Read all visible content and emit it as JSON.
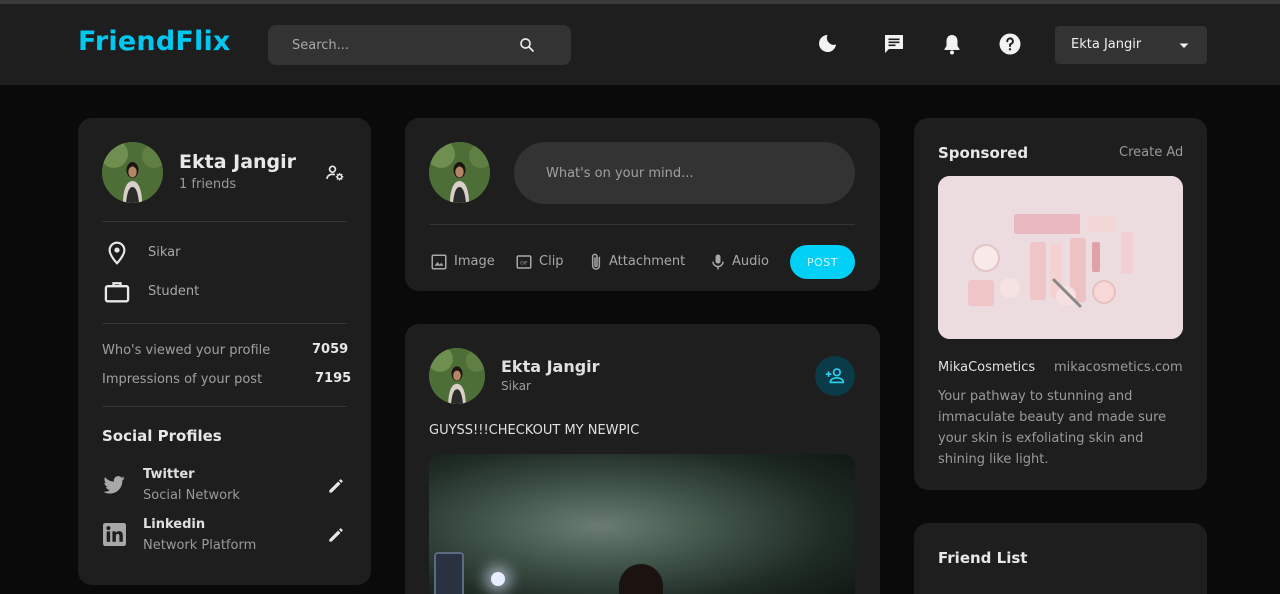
{
  "app": {
    "logo": "FriendFlix"
  },
  "navbar": {
    "search_placeholder": "Search...",
    "icons": [
      "moon-icon",
      "chat-icon",
      "bell-icon",
      "help-icon"
    ],
    "user_name": "Ekta Jangir"
  },
  "colors": {
    "accent": "#00c8f0",
    "background": "#0a0a0a",
    "card": "#1e1e1e",
    "surface": "#333333"
  },
  "profile": {
    "name": "Ekta Jangir",
    "friends": "1 friends",
    "location": "Sikar",
    "occupation": "Student",
    "stats": [
      {
        "label": "Who's viewed your profile",
        "value": "7059"
      },
      {
        "label": "Impressions of your post",
        "value": "7195"
      }
    ],
    "social_title": "Social Profiles",
    "social": [
      {
        "name": "Twitter",
        "type": "Social Network",
        "icon": "twitter-icon"
      },
      {
        "name": "Linkedin",
        "type": "Network Platform",
        "icon": "linkedin-icon"
      }
    ]
  },
  "composer": {
    "placeholder": "What's on your mind...",
    "actions": [
      {
        "label": "Image",
        "icon": "image-icon"
      },
      {
        "label": "Clip",
        "icon": "gif-icon"
      },
      {
        "label": "Attachment",
        "icon": "paperclip-icon"
      },
      {
        "label": "Audio",
        "icon": "microphone-icon"
      }
    ],
    "post_label": "POST"
  },
  "post": {
    "author": "Ekta Jangir",
    "location": "Sikar",
    "text": "GUYSS!!!CHECKOUT MY NEWPIC"
  },
  "sponsored": {
    "title": "Sponsored",
    "create_ad": "Create Ad",
    "brand": "MikaCosmetics",
    "url": "mikacosmetics.com",
    "description": "Your pathway to stunning and immaculate beauty and made sure your skin is exfoliating skin and shining like light."
  },
  "friend_list": {
    "title": "Friend List"
  }
}
